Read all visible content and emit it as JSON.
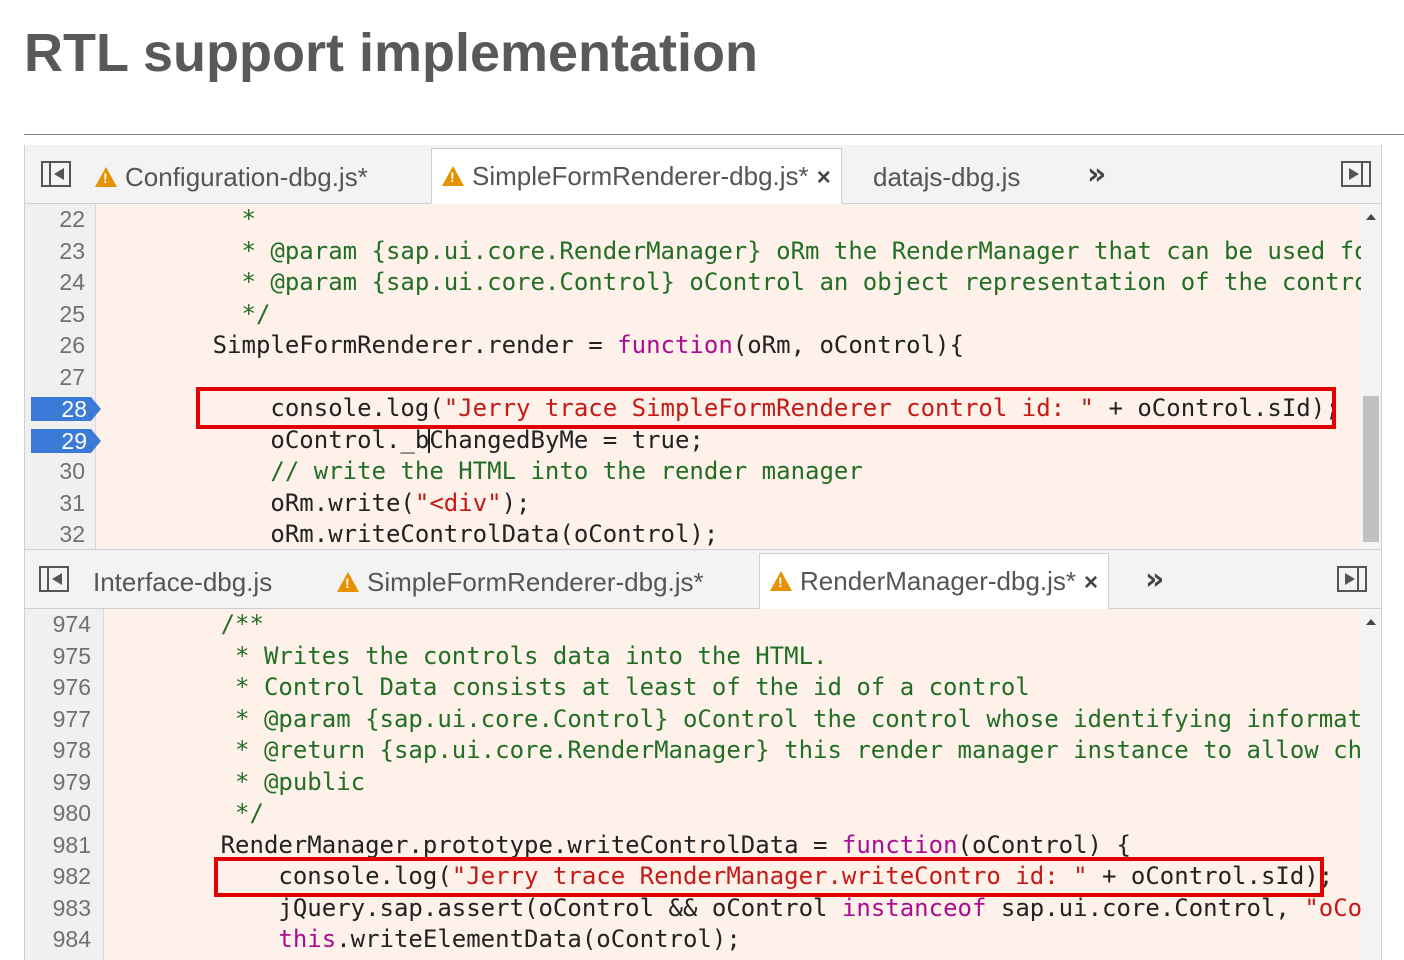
{
  "slide": {
    "title": "RTL support implementation"
  },
  "top_pane": {
    "tabs": [
      {
        "label": "Configuration-dbg.js*",
        "warning": true,
        "active": false
      },
      {
        "label": "SimpleFormRenderer-dbg.js*",
        "warning": true,
        "active": true
      },
      {
        "label": "datajs-dbg.js",
        "warning": false,
        "active": false
      }
    ],
    "more_tabs": "»",
    "close_glyph": "×",
    "breakpoint_lines": [
      "28",
      "29"
    ],
    "lines": [
      {
        "n": "22",
        "tokens": [
          {
            "t": "          *",
            "c": "comment"
          }
        ]
      },
      {
        "n": "23",
        "tokens": [
          {
            "t": "          * @param {sap.ui.core.RenderManager} oRm the RenderManager that can be used for",
            "c": "comment"
          }
        ]
      },
      {
        "n": "24",
        "tokens": [
          {
            "t": "          * @param {sap.ui.core.Control} oControl an object representation of the control",
            "c": "comment"
          }
        ]
      },
      {
        "n": "25",
        "tokens": [
          {
            "t": "          */",
            "c": "comment"
          }
        ]
      },
      {
        "n": "26",
        "tokens": [
          {
            "t": "        SimpleFormRenderer.render = ",
            "c": ""
          },
          {
            "t": "function",
            "c": "kw"
          },
          {
            "t": "(oRm, oControl){",
            "c": ""
          }
        ]
      },
      {
        "n": "27",
        "tokens": [
          {
            "t": "",
            "c": ""
          }
        ]
      },
      {
        "n": "28",
        "tokens": [
          {
            "t": "            console.log(",
            "c": ""
          },
          {
            "t": "\"Jerry trace SimpleFormRenderer control id: \"",
            "c": "string"
          },
          {
            "t": " + oControl.sId);",
            "c": ""
          }
        ]
      },
      {
        "n": "29",
        "tokens": [
          {
            "t": "            oControl._b",
            "c": ""
          },
          {
            "t": "",
            "c": "caret"
          },
          {
            "t": "ChangedByMe = true;",
            "c": ""
          }
        ]
      },
      {
        "n": "30",
        "tokens": [
          {
            "t": "            // write the HTML into the render manager",
            "c": "comment"
          }
        ]
      },
      {
        "n": "31",
        "tokens": [
          {
            "t": "            oRm.write(",
            "c": ""
          },
          {
            "t": "\"<div\"",
            "c": "string"
          },
          {
            "t": ");",
            "c": ""
          }
        ]
      },
      {
        "n": "32",
        "tokens": [
          {
            "t": "            oRm.writeControlData(oControl);",
            "c": ""
          }
        ]
      }
    ]
  },
  "bottom_pane": {
    "tabs": [
      {
        "label": "Interface-dbg.js",
        "warning": false,
        "active": false
      },
      {
        "label": "SimpleFormRenderer-dbg.js*",
        "warning": true,
        "active": false
      },
      {
        "label": "RenderManager-dbg.js*",
        "warning": true,
        "active": true
      }
    ],
    "more_tabs": "»",
    "close_glyph": "×",
    "breakpoint_lines": [],
    "lines": [
      {
        "n": "974",
        "tokens": [
          {
            "t": "        /**",
            "c": "comment"
          }
        ]
      },
      {
        "n": "975",
        "tokens": [
          {
            "t": "         * Writes the controls data into the HTML.",
            "c": "comment"
          }
        ]
      },
      {
        "n": "976",
        "tokens": [
          {
            "t": "         * Control Data consists at least of the id of a control",
            "c": "comment"
          }
        ]
      },
      {
        "n": "977",
        "tokens": [
          {
            "t": "         * @param {sap.ui.core.Control} oControl the control whose identifying informati",
            "c": "comment"
          }
        ]
      },
      {
        "n": "978",
        "tokens": [
          {
            "t": "         * @return {sap.ui.core.RenderManager} this render manager instance to allow cha",
            "c": "comment"
          }
        ]
      },
      {
        "n": "979",
        "tokens": [
          {
            "t": "         * @public",
            "c": "comment"
          }
        ]
      },
      {
        "n": "980",
        "tokens": [
          {
            "t": "         */",
            "c": "comment"
          }
        ]
      },
      {
        "n": "981",
        "tokens": [
          {
            "t": "        RenderManager.prototype.writeControlData = ",
            "c": ""
          },
          {
            "t": "function",
            "c": "kw"
          },
          {
            "t": "(oControl) {",
            "c": ""
          }
        ]
      },
      {
        "n": "982",
        "tokens": [
          {
            "t": "            console.log(",
            "c": ""
          },
          {
            "t": "\"Jerry trace RenderManager.writeContro id: \"",
            "c": "string"
          },
          {
            "t": " + oControl.sId);",
            "c": ""
          }
        ]
      },
      {
        "n": "983",
        "tokens": [
          {
            "t": "            jQuery.sap.assert(oControl && oControl ",
            "c": ""
          },
          {
            "t": "instanceof",
            "c": "kw"
          },
          {
            "t": " sap.ui.core.Control, ",
            "c": ""
          },
          {
            "t": "\"oCon",
            "c": "string"
          }
        ]
      },
      {
        "n": "984",
        "tokens": [
          {
            "t": "            ",
            "c": ""
          },
          {
            "t": "this",
            "c": "kw"
          },
          {
            "t": ".writeElementData(oControl);",
            "c": ""
          }
        ]
      }
    ]
  }
}
